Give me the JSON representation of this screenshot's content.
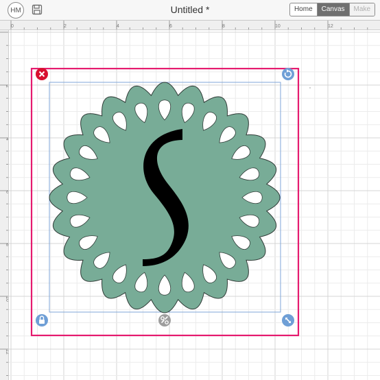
{
  "header": {
    "avatar_initials": "HM",
    "document_title": "Untitled *",
    "modes": [
      {
        "label": "Home",
        "state": "normal"
      },
      {
        "label": "Canvas",
        "state": "active"
      },
      {
        "label": "Make",
        "state": "disabled"
      }
    ]
  },
  "ruler": {
    "top_labels": [
      "0",
      "2",
      "4",
      "6",
      "8",
      "10",
      "12"
    ],
    "left_labels": [
      "2",
      "4",
      "6",
      "8",
      "10",
      "12"
    ]
  },
  "canvas": {
    "letter": "S",
    "shape_fill": "#78ac97",
    "selection_color": "#e5196e",
    "handle_color": "#6f9fd6",
    "delete_handle_color": "#d8102f",
    "handles": [
      "close-icon",
      "rotate-icon",
      "lock-icon",
      "unlink-icon",
      "resize-icon"
    ]
  }
}
